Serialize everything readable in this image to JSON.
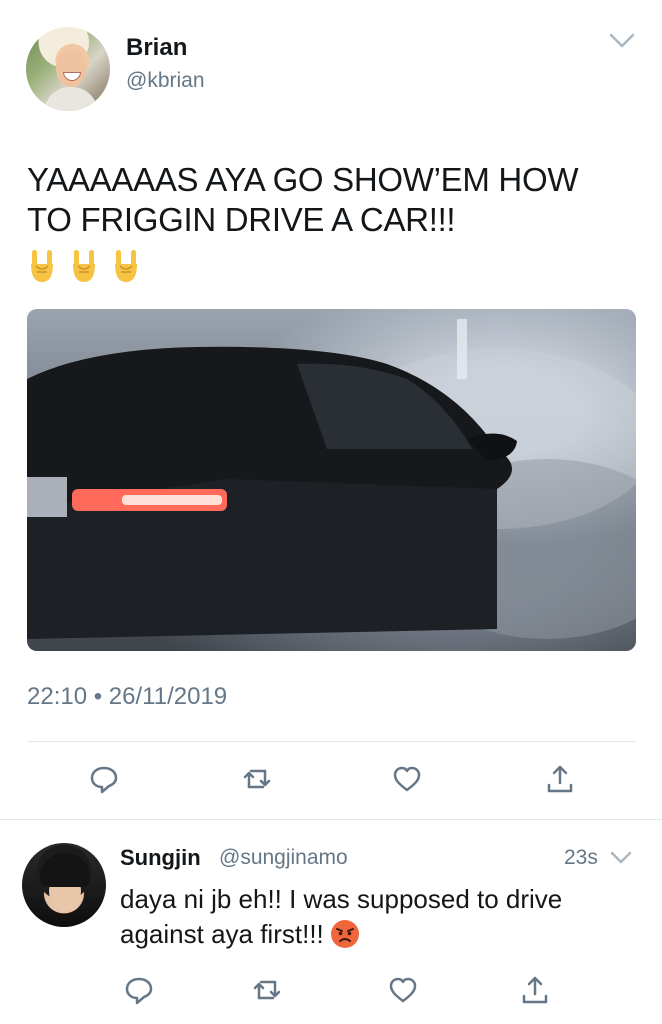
{
  "tweet": {
    "user": {
      "name": "Brian",
      "handle": "@kbrian"
    },
    "text": "YAAAAAAS AYA GO SHOW’EM HOW TO FRIGGIN DRIVE A CAR!!!",
    "emojis": [
      "sign-of-the-horns-emoji",
      "sign-of-the-horns-emoji",
      "sign-of-the-horns-emoji"
    ],
    "timestamp": "22:10 • 26/11/2019"
  },
  "reply": {
    "user": {
      "name": "Sungjin",
      "handle": "@sungjinamo"
    },
    "age": "23s",
    "text": "daya ni jb eh!! I was supposed to drive against aya first!!!",
    "emoji": "angry-face-emoji"
  },
  "icons": [
    "reply-icon",
    "retweet-icon",
    "like-icon",
    "share-icon",
    "chevron-down-icon"
  ],
  "colors": {
    "secondary_text": "#657786",
    "divider": "#e1e8ed",
    "text": "#14171a"
  }
}
